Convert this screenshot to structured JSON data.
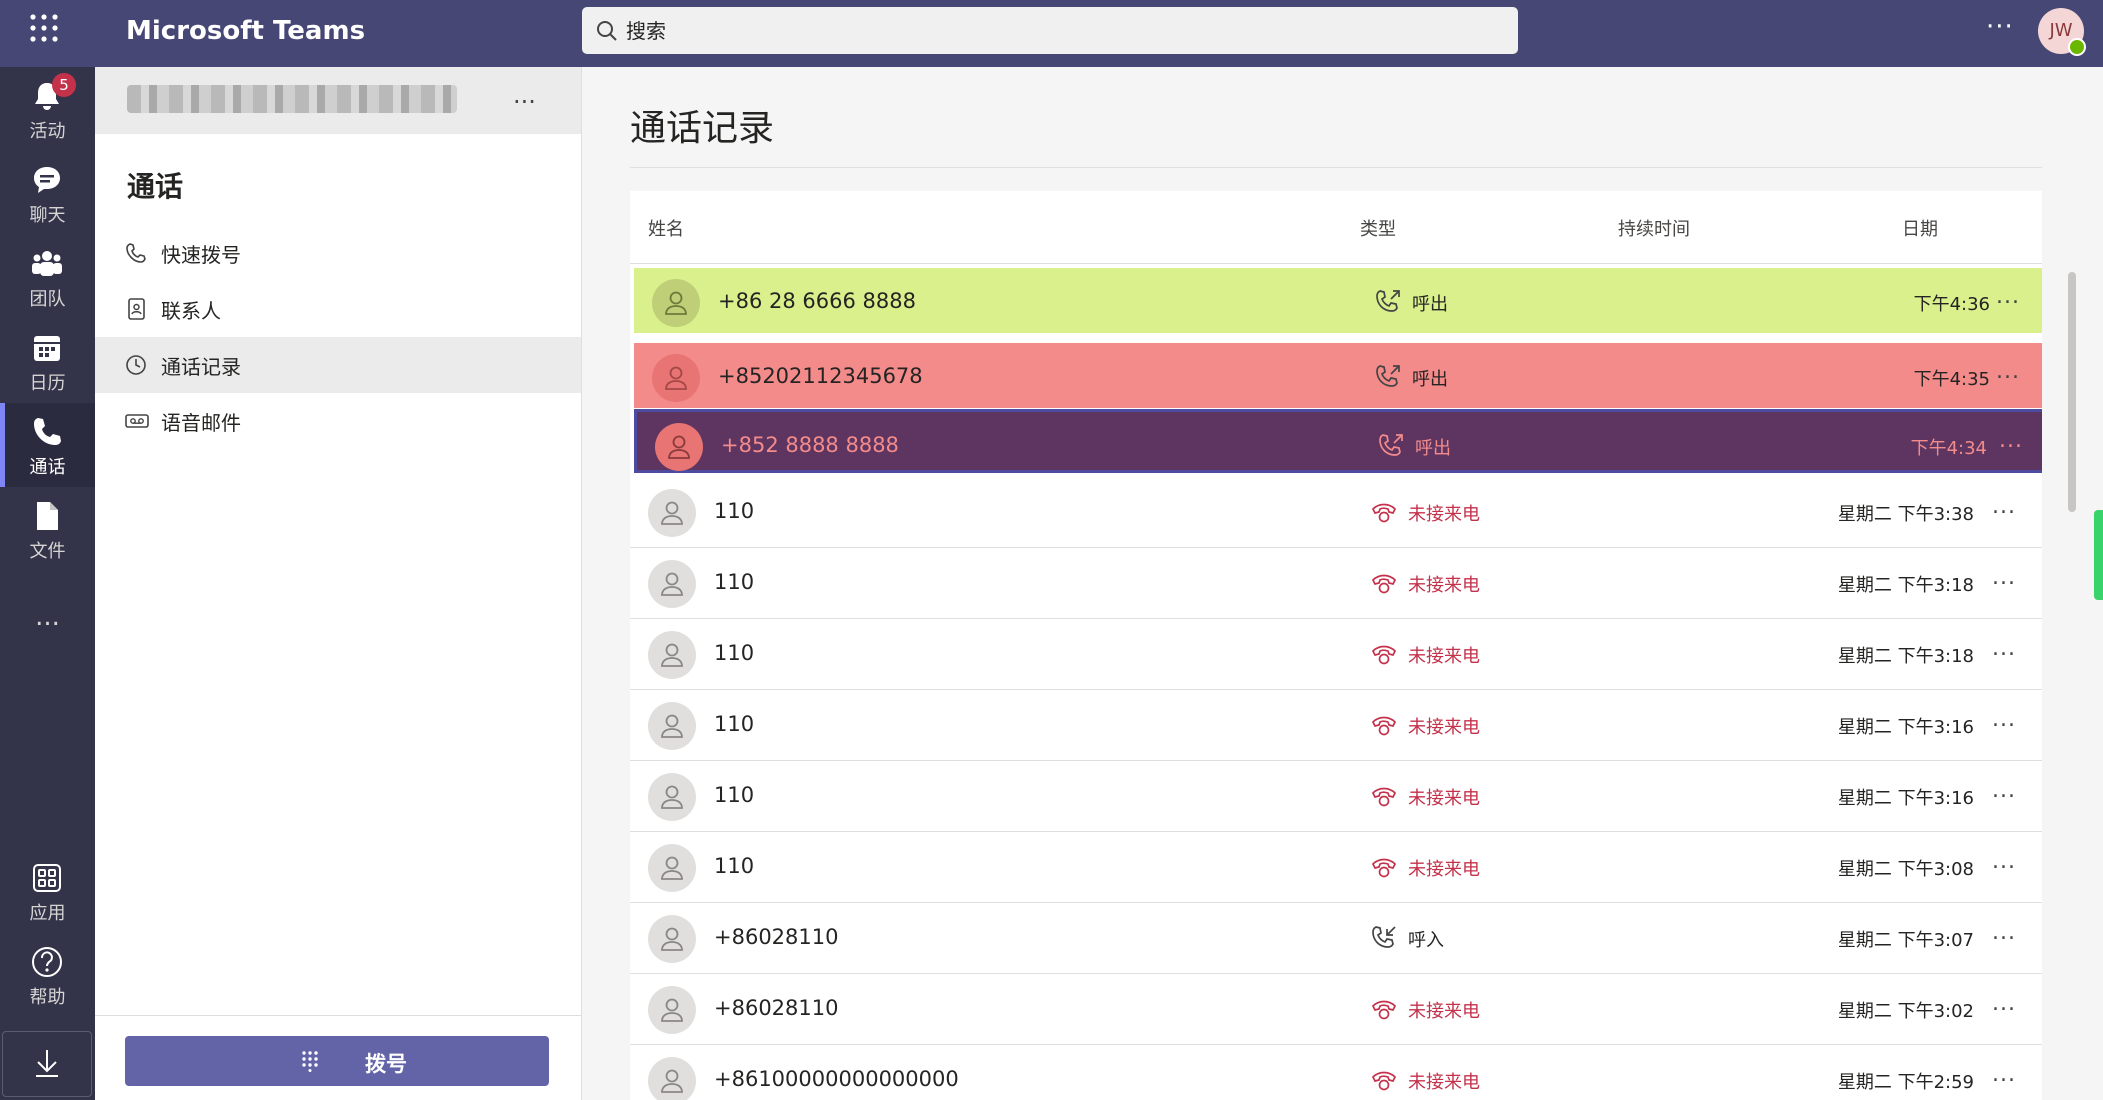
{
  "app": {
    "title": "Microsoft Teams"
  },
  "search": {
    "placeholder": "搜索"
  },
  "user": {
    "initials": "JW"
  },
  "rail": {
    "items": [
      {
        "label": "活动",
        "badge": "5"
      },
      {
        "label": "聊天"
      },
      {
        "label": "团队"
      },
      {
        "label": "日历"
      },
      {
        "label": "通话"
      },
      {
        "label": "文件"
      }
    ],
    "more": "...",
    "apps": "应用",
    "help": "帮助"
  },
  "sidepanel": {
    "more": "...",
    "title": "通话",
    "nav": [
      {
        "label": "快速拨号"
      },
      {
        "label": "联系人"
      },
      {
        "label": "通话记录"
      },
      {
        "label": "语音邮件"
      }
    ],
    "dial_label": "拨号"
  },
  "main": {
    "title": "通话记录",
    "columns": {
      "name": "姓名",
      "type": "类型",
      "duration": "持续时间",
      "date": "日期"
    },
    "rows": [
      {
        "name": "+86 28 6666 8888",
        "type": "呼出",
        "date": "下午4:36"
      },
      {
        "name": "+85202112345678",
        "type": "呼出",
        "date": "下午4:35"
      },
      {
        "name": "+852 8888 8888",
        "type": "呼出",
        "date": "下午4:34"
      },
      {
        "name": "110",
        "type": "未接来电",
        "date": "星期二 下午3:38"
      },
      {
        "name": "110",
        "type": "未接来电",
        "date": "星期二 下午3:18"
      },
      {
        "name": "110",
        "type": "未接来电",
        "date": "星期二 下午3:18"
      },
      {
        "name": "110",
        "type": "未接来电",
        "date": "星期二 下午3:16"
      },
      {
        "name": "110",
        "type": "未接来电",
        "date": "星期二 下午3:16"
      },
      {
        "name": "110",
        "type": "未接来电",
        "date": "星期二 下午3:08"
      },
      {
        "name": "+86028110",
        "type": "呼入",
        "date": "星期二 下午3:07"
      },
      {
        "name": "+86028110",
        "type": "未接来电",
        "date": "星期二 下午3:02"
      },
      {
        "name": "+86100000000000000",
        "type": "未接来电",
        "date": "星期二 下午2:59"
      }
    ],
    "row_more": "..."
  },
  "colors": {
    "topbar": "#464775",
    "rail": "#33344a",
    "accent": "#6264a7",
    "missed": "#c4314b",
    "highlight_green": "#d9f08c",
    "highlight_red": "#f48b8b",
    "highlight_purple": "#5e3560"
  }
}
